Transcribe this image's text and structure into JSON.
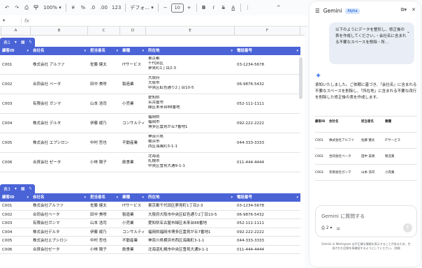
{
  "toolbar": {
    "undo": "↶",
    "redo": "↷",
    "print": "⎙",
    "paint": "🖌",
    "zoom": "100%",
    "currency": "¥",
    "percent": "%",
    "dec_decrease": ".0",
    "dec_increase": ".00",
    "format_number": "123",
    "font": "デフォ...",
    "font_size": "10",
    "bold": "B",
    "italic": "I",
    "strike": "S",
    "text_color": "A",
    "more": "⋮",
    "collapse": "^"
  },
  "formula_bar": {
    "name_box": "▾",
    "fx": "fx"
  },
  "columns": [
    "A",
    "B",
    "C",
    "D",
    "E",
    "F"
  ],
  "table1": {
    "tag": "表1",
    "headers": [
      "顧客ID",
      "会社名",
      "担当者名",
      "業種",
      "所在地",
      "電話番号"
    ],
    "rows": [
      {
        "id": "C001",
        "company": "株式会社 アルファ",
        "person": "佐藤 健太",
        "industry": "ITサービス",
        "address": [
          "東京都",
          "千代田区",
          "夢見町1丁目2-3"
        ],
        "phone": "03-1234-5678"
      },
      {
        "id": "C002",
        "company": "合同会社 ベータ",
        "person": "田中 美咲",
        "industry": "製造業",
        "address": [
          "大阪府",
          "大阪市",
          "中央区虹色通り2丁目10-5"
        ],
        "phone": "06-9876-5432"
      },
      {
        "id": "C003",
        "company": "有限会社 ガンマ",
        "person": "山本 浩司",
        "industry": "小売業",
        "address": [
          "愛知県",
          "名古屋市",
          "緑区未来台88番地"
        ],
        "phone": "052-111-1111"
      },
      {
        "id": "C004",
        "company": "株式会社 デルタ",
        "person": "伊藤 綾乃",
        "industry": "コンサルティ",
        "address": [
          "福岡県",
          "福岡市",
          "博多区雲見が丘7番地1"
        ],
        "phone": "092-222-2222"
      },
      {
        "id": "C005",
        "company": "株式会社 エプシロン",
        "person": "中村 哲也",
        "industry": "不動産業",
        "address": [
          "神奈川県",
          "横浜市",
          "西区海風町3-1-1"
        ],
        "phone": "044-333-3333"
      },
      {
        "id": "C006",
        "company": "合資会社 ゼータ",
        "person": "小林 陽子",
        "industry": "飲食業",
        "address": [
          "北海道",
          "札幌市",
          "中央区雪見大通9-1-1"
        ],
        "phone": "011-444-4444"
      }
    ]
  },
  "table3": {
    "tag": "表3",
    "headers": [
      "顧客ID",
      "会社名",
      "担当者名",
      "業種",
      "所在地",
      "電話番号"
    ],
    "rows": [
      {
        "id": "C001",
        "company": "株式会社アルファ",
        "person": "佐藤 健太",
        "industry": "ITサービス",
        "address": "東京都千代田区夢見町1丁目2-3",
        "phone": "03-1234-5678"
      },
      {
        "id": "C002",
        "company": "合同会社ベータ",
        "person": "田中 美咲",
        "industry": "製造業",
        "address": "大阪府大阪市中央区虹色通り2丁目10-5",
        "phone": "06-9876-5432"
      },
      {
        "id": "C003",
        "company": "有限会社ガンマ",
        "person": "山本 浩司",
        "industry": "小売業",
        "address": "愛知県名古屋市緑区未来台88番地",
        "phone": "052-111-1111"
      },
      {
        "id": "C004",
        "company": "株式会社デルタ",
        "person": "伊藤 綾乃",
        "industry": "コンサルティ",
        "address": "福岡県福岡市博多区雲見が丘7番地1",
        "phone": "092-222-2222"
      },
      {
        "id": "C005",
        "company": "株式会社エプシロン",
        "person": "中村 哲也",
        "industry": "不動産業",
        "address": "神奈川県横浜市西区海風町3-1-1",
        "phone": "044-333-3333"
      },
      {
        "id": "C006",
        "company": "合資会社ゼータ",
        "person": "小林 陽子",
        "industry": "飲食業",
        "address": "北海道札幌市中央区雪見大通9-1-1",
        "phone": "011-444-4444"
      }
    ]
  },
  "gemini": {
    "title": "Gemini",
    "badge": "Alpha",
    "user_message": "以下のようにデータを整形し、修正後の表を作成してください。・会社名に含まれる不要なスペースを削除・所...",
    "answer": "承知いたしました。ご依頼に基づき、「会社名」に含まれる不要なスペースを削除し、「所在地」に含まれる不要な改行を削除した修正後の表を作成します。",
    "mini_headers": [
      "顧客ID",
      "会社名",
      "担当者名",
      "業種"
    ],
    "mini_rows": [
      [
        "C001",
        "株式会社アルファ",
        "佐藤 健太",
        "ITサービス"
      ],
      [
        "C002",
        "合同会社ベータ",
        "田中 美咲",
        "製造業"
      ],
      [
        "C003",
        "有限会社ガンマ",
        "山本 浩司",
        "小売業"
      ]
    ],
    "input_placeholder": "Gemini に質問する",
    "disclaimer": "Gemini in Workspace は不正確な情報を表示することがあるため、生成された回答を再確認するようにしてください。 詳細"
  }
}
